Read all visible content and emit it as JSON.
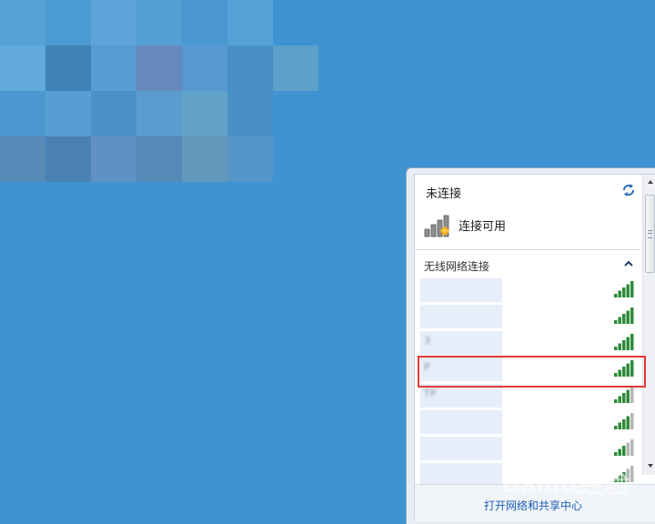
{
  "colors": {
    "desktop": "#3e93d0",
    "highlight": "#e53935",
    "signal": "#2e8b3a",
    "link": "#1a5fb4"
  },
  "status": {
    "title": "未连接",
    "connection_label": "连接可用"
  },
  "section": {
    "title": "无线网络连接"
  },
  "networks": [
    {
      "name": "",
      "signal_bars": 5
    },
    {
      "name": "",
      "signal_bars": 5
    },
    {
      "name": "3",
      "signal_bars": 5
    },
    {
      "name": "P",
      "signal_bars": 5,
      "highlighted": true
    },
    {
      "name": "TP",
      "signal_bars": 4
    },
    {
      "name": "",
      "signal_bars": 4
    },
    {
      "name": "",
      "signal_bars": 3
    },
    {
      "name": "",
      "signal_bars": 3
    }
  ],
  "footer": {
    "link": "打开网络和共享中心"
  },
  "watermark": "Baidu经验"
}
